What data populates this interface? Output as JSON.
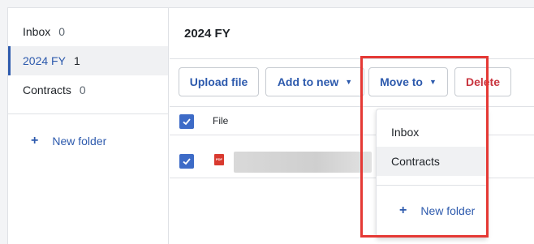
{
  "sidebar": {
    "folders": [
      {
        "name": "Inbox",
        "count": "0"
      },
      {
        "name": "2024 FY",
        "count": "1"
      },
      {
        "name": "Contracts",
        "count": "0"
      }
    ],
    "new_folder_label": "New folder"
  },
  "main": {
    "title": "2024 FY",
    "toolbar": {
      "upload_label": "Upload file",
      "add_to_new_label": "Add to new",
      "move_to_label": "Move to",
      "delete_label": "Delete"
    },
    "table": {
      "file_header": "File",
      "rows": [
        {
          "selected": true,
          "type_badge": "PDF",
          "name_obscured": true
        }
      ]
    }
  },
  "move_to_menu": {
    "items": [
      "Inbox",
      "Contracts"
    ],
    "new_folder_label": "New folder"
  },
  "colors": {
    "accent": "#2d5aad",
    "checkbox": "#3d6bc7",
    "delete": "#c8353f",
    "highlight": "#e53935"
  }
}
